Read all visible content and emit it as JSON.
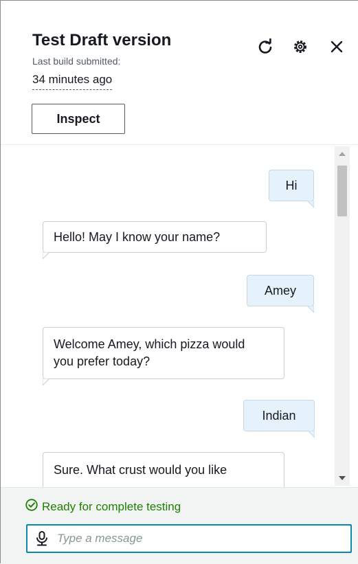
{
  "header": {
    "title": "Test Draft version",
    "subtitle": "Last build submitted:",
    "time_ago": "34 minutes ago",
    "inspect_label": "Inspect"
  },
  "icons": {
    "refresh": "refresh-icon",
    "settings": "gear-icon",
    "close": "close-icon",
    "microphone": "microphone-icon",
    "status": "check-circle-icon"
  },
  "messages": [
    {
      "sender": "user",
      "text": "Hi"
    },
    {
      "sender": "bot",
      "text": "Hello! May I know your name?"
    },
    {
      "sender": "user",
      "text": "Amey"
    },
    {
      "sender": "bot",
      "text": "Welcome Amey, which pizza would you prefer today?"
    },
    {
      "sender": "user",
      "text": "Indian"
    },
    {
      "sender": "bot",
      "text": "Sure. What crust would you like"
    }
  ],
  "footer": {
    "status_text": "Ready for complete testing",
    "input_placeholder": "Type a message",
    "input_value": ""
  },
  "colors": {
    "user_bubble": "#e6f2fb",
    "bot_bubble": "#ffffff",
    "status_green": "#1d8102",
    "input_focus": "#0a8aa8"
  }
}
